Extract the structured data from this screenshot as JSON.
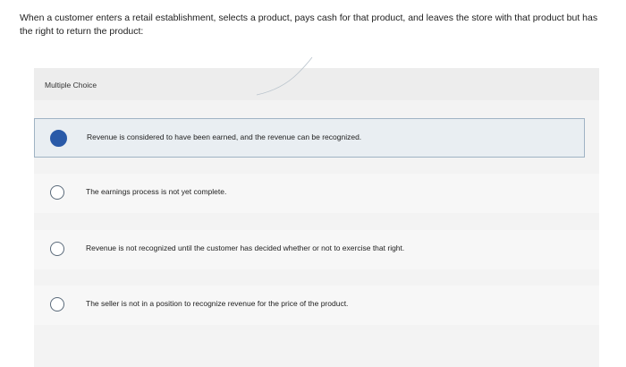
{
  "question": {
    "text": "When a customer enters a retail establishment, selects a product, pays cash for that product, and leaves the store with that product but has the right to return the product:"
  },
  "multiple_choice": {
    "label": "Multiple Choice",
    "options": [
      {
        "text": "Revenue is considered to have been earned, and the revenue can be recognized.",
        "selected": true
      },
      {
        "text": "The earnings process is not yet complete.",
        "selected": false
      },
      {
        "text": "Revenue is not recognized until the customer has decided whether or not to exercise that right.",
        "selected": false
      },
      {
        "text": "The seller is not in a position to recognize revenue for the price of the product.",
        "selected": false
      }
    ]
  },
  "colors": {
    "selected_radio": "#2a5aa8",
    "selected_border": "#9fb3c4"
  }
}
